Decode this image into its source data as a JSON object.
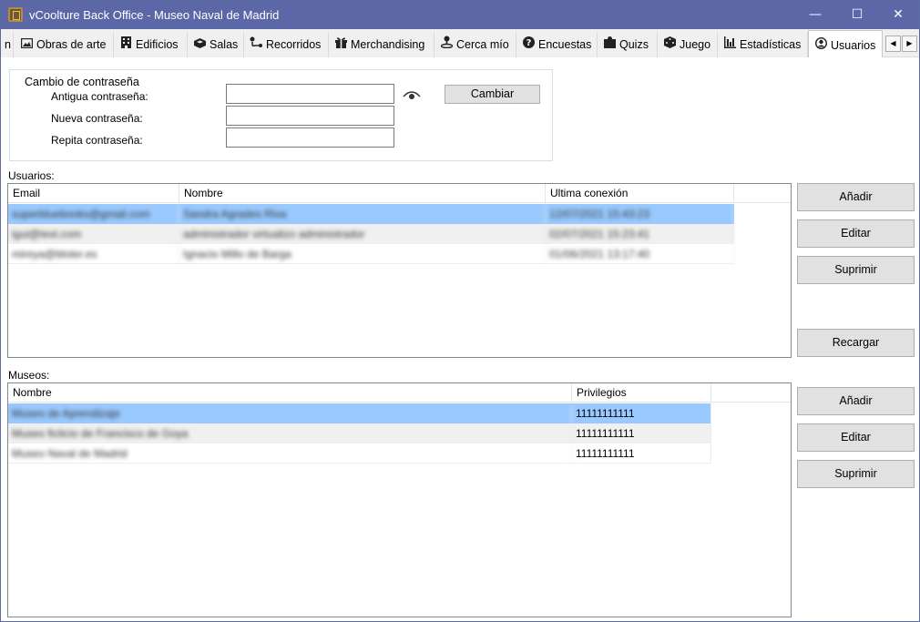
{
  "window": {
    "title": "vCoolture Back Office - Museo Naval de Madrid",
    "controls": {
      "minimize": "—",
      "maximize": "☐",
      "close": "✕"
    }
  },
  "tabs": [
    {
      "label": "n",
      "icon": ""
    },
    {
      "label": "Obras de arte",
      "icon": "picture-icon"
    },
    {
      "label": "Edificios",
      "icon": "building-icon"
    },
    {
      "label": "Salas",
      "icon": "room-icon"
    },
    {
      "label": "Recorridos",
      "icon": "route-icon"
    },
    {
      "label": "Merchandising",
      "icon": "gift-icon"
    },
    {
      "label": "Cerca mío",
      "icon": "location-icon"
    },
    {
      "label": "Encuestas",
      "icon": "question-icon"
    },
    {
      "label": "Quizs",
      "icon": "puzzle-icon"
    },
    {
      "label": "Juego",
      "icon": "dice-icon"
    },
    {
      "label": "Estadísticas",
      "icon": "chart-icon"
    },
    {
      "label": "Usuarios",
      "icon": "user-icon",
      "active": true
    }
  ],
  "tab_scroll": {
    "left": "◀",
    "right": "▶"
  },
  "password_change": {
    "title": "Cambio de contraseña",
    "old_label": "Antigua contraseña:",
    "new_label": "Nueva contraseña:",
    "repeat_label": "Repita contraseña:",
    "old_value": "",
    "new_value": "",
    "repeat_value": "",
    "change_button": "Cambiar"
  },
  "users": {
    "section_label": "Usuarios:",
    "columns": [
      "Email",
      "Nombre",
      "Ultima conexión"
    ],
    "rows": [
      {
        "email": "superbluebooks@gmail.com",
        "name": "Sandra Agrades Riva",
        "last": "12/07/2021 15:43:23"
      },
      {
        "email": "igui@test.com",
        "name": "administrador virtualizo administrador",
        "last": "02/07/2021 15:23:41"
      },
      {
        "email": "mireya@bloter.es",
        "name": "Ignacio Millo de Barga",
        "last": "01/06/2021 13:17:40"
      }
    ],
    "buttons": {
      "add": "Añadir",
      "edit": "Editar",
      "delete": "Suprimir",
      "reload": "Recargar"
    }
  },
  "museums": {
    "section_label": "Museos:",
    "columns": [
      "Nombre",
      "Privilegios"
    ],
    "rows": [
      {
        "name": "Museo de Aprendizaje",
        "privileges": "11111111111"
      },
      {
        "name": "Museo ficticio de Francisco de Goya",
        "privileges": "11111111111"
      },
      {
        "name": "Museo Naval de Madrid",
        "privileges": "11111111111"
      }
    ],
    "buttons": {
      "add": "Añadir",
      "edit": "Editar",
      "delete": "Suprimir"
    }
  },
  "colors": {
    "titlebar": "#5b67a6",
    "selected_row": "#99c9ff",
    "alt_row": "#f0f0f0",
    "button": "#e1e1e1"
  }
}
